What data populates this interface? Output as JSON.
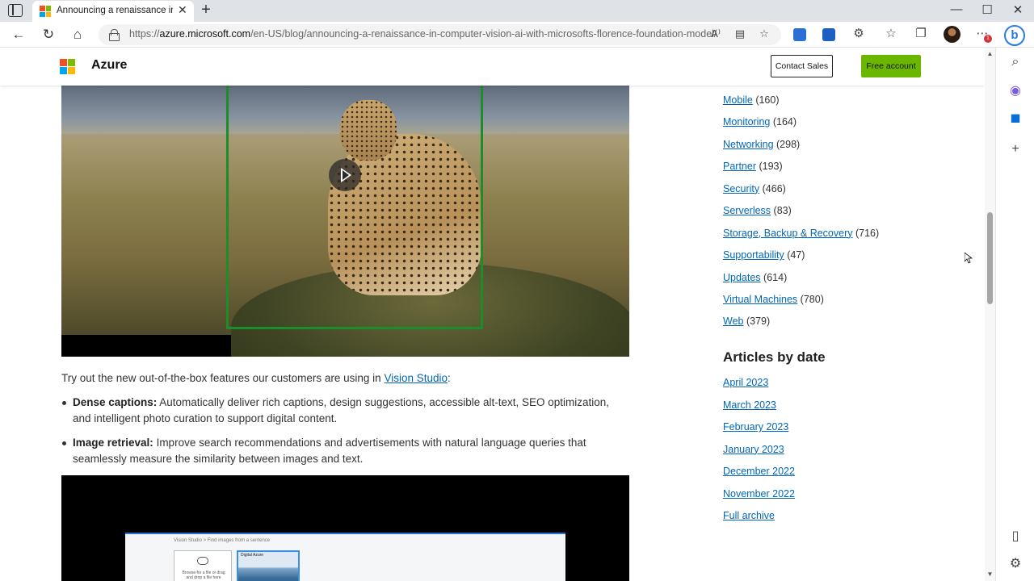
{
  "browser": {
    "tab_title": "Announcing a renaissance in co",
    "url_prefix": "https://",
    "url_host": "azure.microsoft.com",
    "url_path": "/en-US/blog/announcing-a-renaissance-in-computer-vision-ai-with-microsofts-florence-foundation-model/",
    "new_tab": "+",
    "close_tab": "✕",
    "minimize": "—",
    "maximize": "☐",
    "close_window": "✕",
    "notification_count": "1",
    "bing_label": "b",
    "icons": [
      "tab-actions-icon",
      "back-icon",
      "refresh-icon",
      "home-icon",
      "lock-icon",
      "read-aloud-icon",
      "immersive-reader-icon",
      "add-favorite-icon",
      "extension-icon",
      "extensions-puzzle-icon",
      "favorites-icon",
      "collections-icon",
      "profile-icon",
      "more-icon",
      "bing-icon",
      "search-icon",
      "office-icon",
      "outlook-icon",
      "add-icon",
      "sidebar-toggle-icon",
      "settings-icon"
    ]
  },
  "site": {
    "brand": "Azure",
    "contact_sales": "Contact Sales",
    "free_account": "Free account",
    "colors": {
      "accent": "#0067b8",
      "free_btn": "#6bb700",
      "ms_red": "#f25022",
      "ms_green": "#7fba00",
      "ms_blue": "#00a4ef",
      "ms_yellow": "#ffb900"
    }
  },
  "article": {
    "intro_before": "Try out the new out-of-the-box features our customers are using in ",
    "intro_link": "Vision Studio",
    "intro_after": ":",
    "features": [
      {
        "title": "Dense captions:",
        "text": " Automatically deliver rich captions, design suggestions, accessible alt-text, SEO optimization, and intelligent photo curation to support digital content."
      },
      {
        "title": "Image retrieval:",
        "text": " Improve search recommendations and advertisements with natural language queries that seamlessly measure the similarity between images and text."
      }
    ],
    "video2": {
      "crumb": "Vision Studio  >  Find images from a sentence",
      "upload_text": "Browse for a file or drag and drop a file here",
      "thumb_label": "Digital Azure"
    }
  },
  "sidebar": {
    "categories": [
      {
        "name": "Mobile",
        "count": "(160)"
      },
      {
        "name": "Monitoring",
        "count": "(164)"
      },
      {
        "name": "Networking",
        "count": "(298)"
      },
      {
        "name": "Partner",
        "count": "(193)"
      },
      {
        "name": "Security",
        "count": "(466)"
      },
      {
        "name": "Serverless",
        "count": "(83)"
      },
      {
        "name": "Storage, Backup & Recovery",
        "count": "(716)"
      },
      {
        "name": "Supportability",
        "count": "(47)"
      },
      {
        "name": "Updates",
        "count": "(614)"
      },
      {
        "name": "Virtual Machines",
        "count": "(780)"
      },
      {
        "name": "Web",
        "count": "(379)"
      }
    ],
    "date_heading": "Articles by date",
    "dates": [
      "April 2023",
      "March 2023",
      "February 2023",
      "January 2023",
      "December 2022",
      "November 2022",
      "Full archive"
    ]
  }
}
